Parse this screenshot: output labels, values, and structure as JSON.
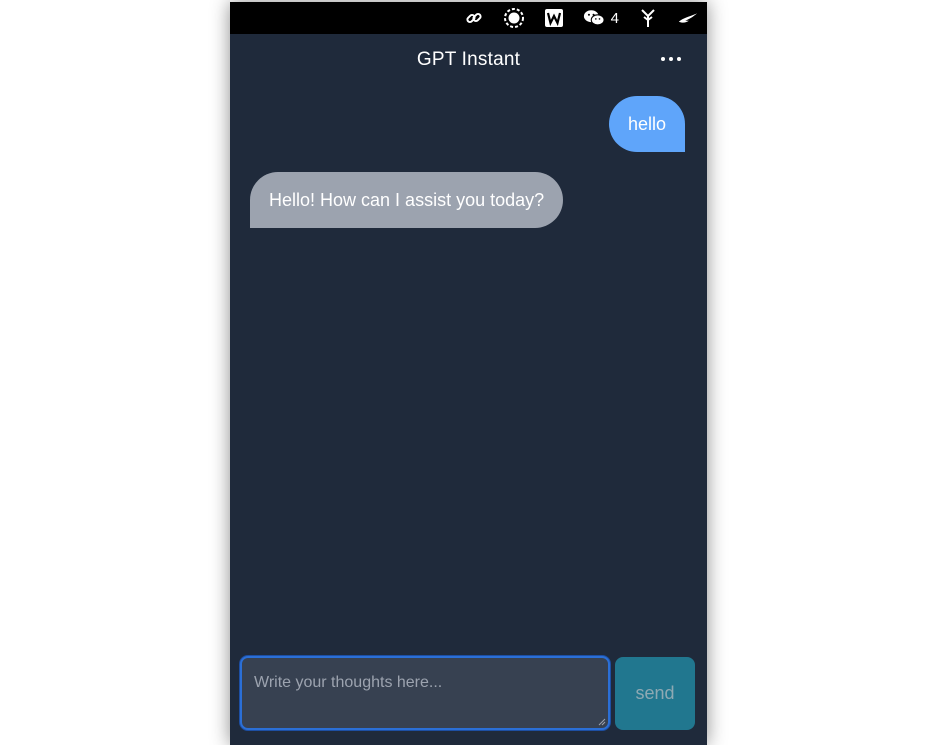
{
  "menubar": {
    "icons": [
      {
        "name": "link-icon"
      },
      {
        "name": "record-icon"
      },
      {
        "name": "wps-icon"
      },
      {
        "name": "wechat-icon"
      },
      {
        "name": "fork-icon"
      },
      {
        "name": "bird-icon"
      }
    ],
    "wechat_count": "4"
  },
  "header": {
    "title": "GPT Instant",
    "more_icon": "more-horizontal-icon"
  },
  "messages": [
    {
      "role": "user",
      "text": "hello"
    },
    {
      "role": "assistant",
      "text": "Hello! How can I assist you today?"
    }
  ],
  "composer": {
    "placeholder": "Write your thoughts here...",
    "value": "",
    "send_label": "send"
  },
  "colors": {
    "background": "#1f2a3b",
    "user_bubble": "#5fa5fa",
    "assistant_bubble": "#9ca3af",
    "input_bg": "#374151",
    "input_focus": "#2b6fd6",
    "send_bg": "#21778f"
  }
}
